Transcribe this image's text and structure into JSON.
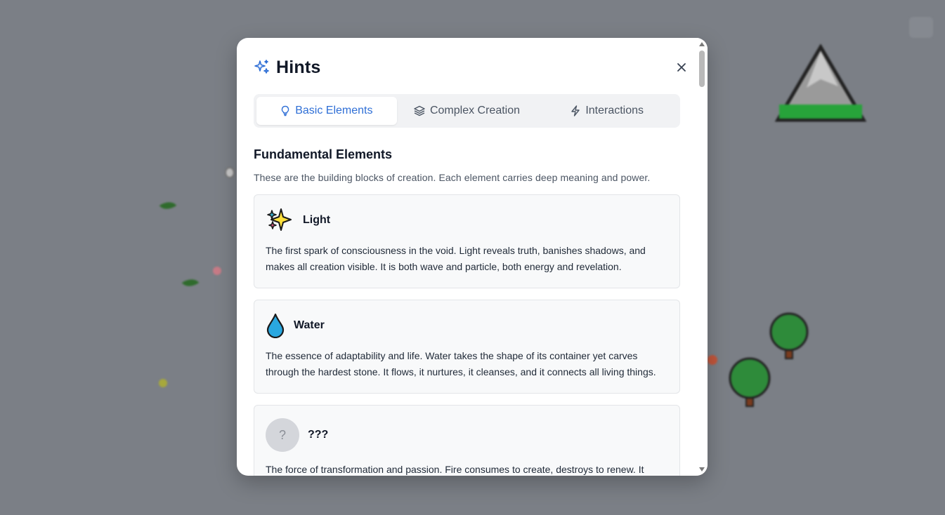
{
  "modal": {
    "title": "Hints",
    "close_label": "×"
  },
  "tabs": [
    {
      "label": "Basic Elements",
      "icon": "lightbulb-icon",
      "active": true
    },
    {
      "label": "Complex Creation",
      "icon": "layers-icon",
      "active": false
    },
    {
      "label": "Interactions",
      "icon": "lightning-icon",
      "active": false
    }
  ],
  "section": {
    "title": "Fundamental Elements",
    "description": "These are the building blocks of creation. Each element carries deep meaning and power."
  },
  "elements": [
    {
      "name": "Light",
      "icon": "sparkles-icon",
      "description": "The first spark of consciousness in the void. Light reveals truth, banishes shadows, and makes all creation visible. It is both wave and particle, both energy and revelation."
    },
    {
      "name": "Water",
      "icon": "droplet-icon",
      "description": "The essence of adaptability and life. Water takes the shape of its container yet carves through the hardest stone. It flows, it nurtures, it cleanses, and it connects all living things."
    },
    {
      "name": "???",
      "icon": "question-icon",
      "placeholder_symbol": "?",
      "description": "The force of transformation and passion. Fire consumes to create, destroys to renew. It"
    }
  ],
  "colors": {
    "accent": "#2f6fd6",
    "backdrop": "#7b7f86",
    "card_bg": "#f8f9fa"
  }
}
